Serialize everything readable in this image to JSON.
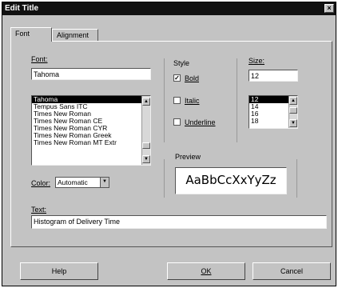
{
  "window": {
    "title": "Edit Title",
    "close_glyph": "×"
  },
  "tabs": [
    {
      "label": "Font",
      "active": true
    },
    {
      "label": "Alignment",
      "active": false
    }
  ],
  "font": {
    "label": "Font:",
    "value": "Tahoma",
    "list": [
      "Tahoma",
      "Tempus Sans ITC",
      "Times New Roman",
      "Times New Roman CE",
      "Times New Roman CYR",
      "Times New Roman Greek",
      "Times New Roman MT Extr"
    ],
    "selected_index": 0
  },
  "style": {
    "label": "Style",
    "bold": {
      "label": "Bold",
      "checked": true
    },
    "italic": {
      "label": "Italic",
      "checked": false
    },
    "underline": {
      "label": "Underline",
      "checked": false
    }
  },
  "size": {
    "label": "Size:",
    "value": "12",
    "list": [
      "12",
      "14",
      "16",
      "18"
    ],
    "selected_index": 0
  },
  "color": {
    "label": "Color:",
    "value": "Automatic"
  },
  "preview": {
    "label": "Preview",
    "sample": "AaBbCcXxYyZz"
  },
  "text": {
    "label": "Text:",
    "value": "Histogram of Delivery Time"
  },
  "buttons": {
    "help": "Help",
    "ok": "OK",
    "cancel": "Cancel"
  },
  "icons": {
    "scroll_up": "▲",
    "scroll_down": "▼",
    "check": "✓"
  }
}
